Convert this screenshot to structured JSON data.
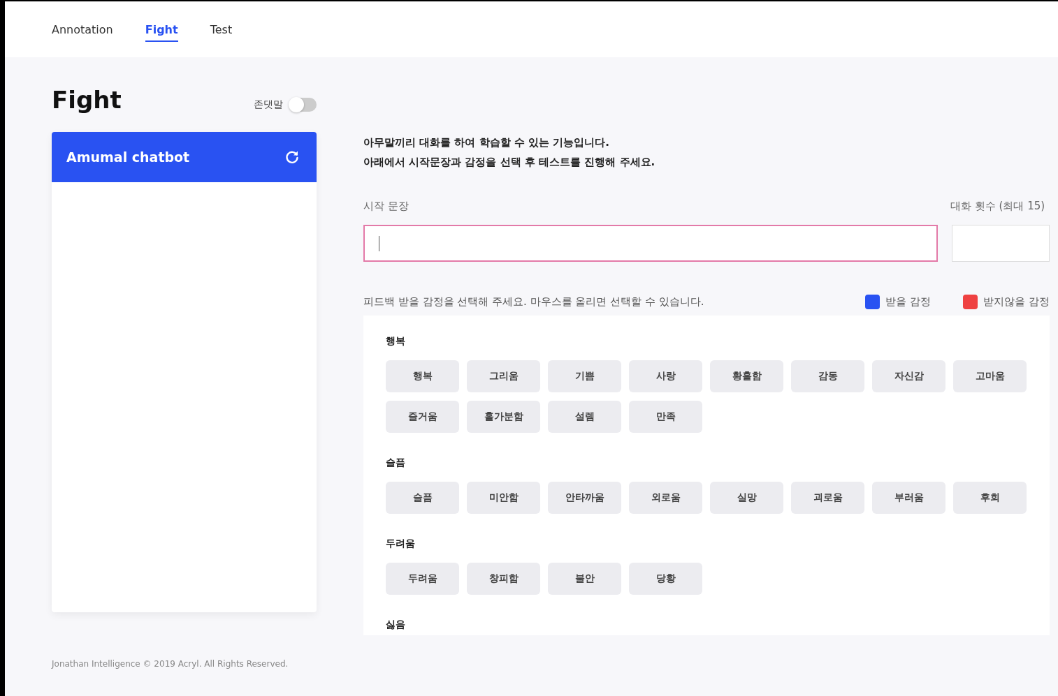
{
  "nav": {
    "tabs": [
      {
        "label": "Annotation",
        "selected": false
      },
      {
        "label": "Fight",
        "selected": true
      },
      {
        "label": "Test",
        "selected": false
      }
    ]
  },
  "page_title": "Fight",
  "honorific_toggle": {
    "label": "존댓말",
    "on": false
  },
  "chat_panel": {
    "title": "Amumal chatbot"
  },
  "description": [
    "아무말끼리 대화를 하여 학습할 수 있는 기능입니다.",
    "아래에서 시작문장과 감정을 선택 후 테스트를 진행해 주세요."
  ],
  "start_sentence": {
    "label": "시작 문장",
    "focused": true
  },
  "turn_count": {
    "label": "대화 횟수 (최대 15)",
    "focused": false
  },
  "emotion_hint": "피드백 받을 감정을 선택해 주세요. 마우스를 올리면 선택할 수 있습니다.",
  "legend": [
    {
      "label": "받을 감정",
      "color": "#2952f2"
    },
    {
      "label": "받지않을 감정",
      "color": "#ef4141"
    }
  ],
  "emotion_groups": [
    {
      "title": "행복",
      "emotions": [
        {
          "label": "행복",
          "selected": false
        },
        {
          "label": "그리움",
          "selected": false
        },
        {
          "label": "기쁨",
          "selected": false
        },
        {
          "label": "사랑",
          "selected": false
        },
        {
          "label": "황홀함",
          "selected": false
        },
        {
          "label": "감동",
          "selected": false
        },
        {
          "label": "자신감",
          "selected": false
        },
        {
          "label": "고마움",
          "selected": false
        },
        {
          "label": "즐거움",
          "selected": false
        },
        {
          "label": "홀가분함",
          "selected": false
        },
        {
          "label": "설렘",
          "selected": false
        },
        {
          "label": "만족",
          "selected": false
        }
      ]
    },
    {
      "title": "슬픔",
      "emotions": [
        {
          "label": "슬픔",
          "selected": false
        },
        {
          "label": "미안함",
          "selected": false
        },
        {
          "label": "안타까움",
          "selected": false
        },
        {
          "label": "외로움",
          "selected": false
        },
        {
          "label": "실망",
          "selected": false
        },
        {
          "label": "괴로움",
          "selected": false
        },
        {
          "label": "부러움",
          "selected": false
        },
        {
          "label": "후회",
          "selected": false
        }
      ]
    },
    {
      "title": "두려움",
      "emotions": [
        {
          "label": "두려움",
          "selected": false
        },
        {
          "label": "창피함",
          "selected": false
        },
        {
          "label": "불안",
          "selected": false
        },
        {
          "label": "당황",
          "selected": false
        }
      ]
    },
    {
      "title": "싫음"
    }
  ],
  "footer": "Jonathan Intelligence © 2019 Acryl. All Rights Reserved."
}
